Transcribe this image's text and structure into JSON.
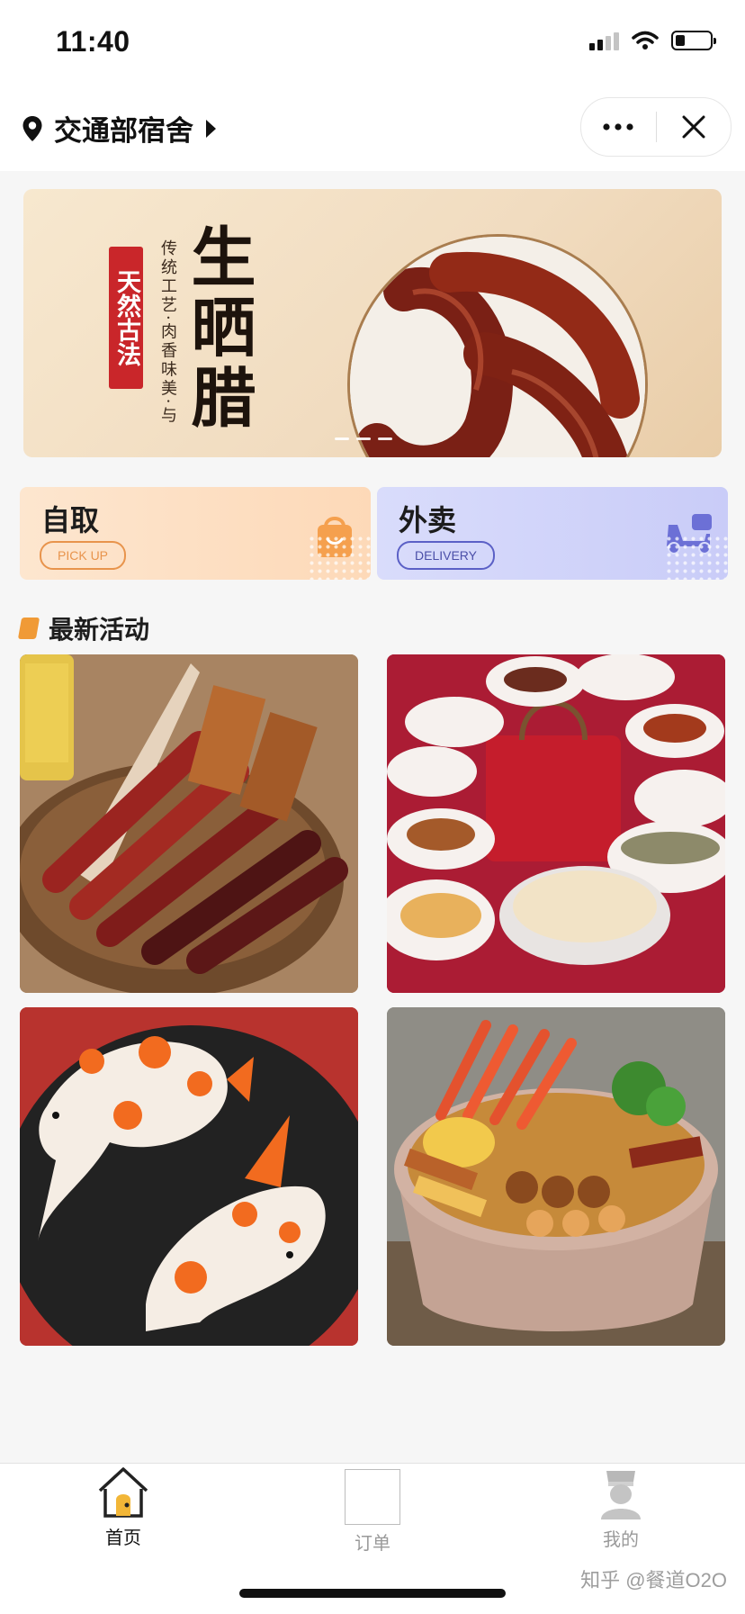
{
  "status_bar": {
    "time": "11:40"
  },
  "header": {
    "location": "交通部宿舍",
    "icons": [
      "location-pin-icon",
      "caret-right-icon",
      "more-icon",
      "close-icon"
    ]
  },
  "banner": {
    "stamp": "天然古法",
    "small_text": "传统工艺·肉香味美·与",
    "big_title": "生晒腊"
  },
  "services": [
    {
      "title": "自取",
      "subtitle": "PICK UP",
      "icon": "shopping-bag-icon",
      "color": "#f5a04e"
    },
    {
      "title": "外卖",
      "subtitle": "DELIVERY",
      "icon": "scooter-icon",
      "color": "#6c70d6"
    }
  ],
  "section": {
    "title": "最新活动",
    "accent": "#f09a36"
  },
  "tabs": [
    {
      "label": "首页",
      "icon": "home-icon",
      "active": true
    },
    {
      "label": "订单",
      "icon": "orders-icon",
      "active": false
    },
    {
      "label": "我的",
      "icon": "chef-profile-icon",
      "active": false
    }
  ],
  "watermark": "知乎 @餐道O2O"
}
